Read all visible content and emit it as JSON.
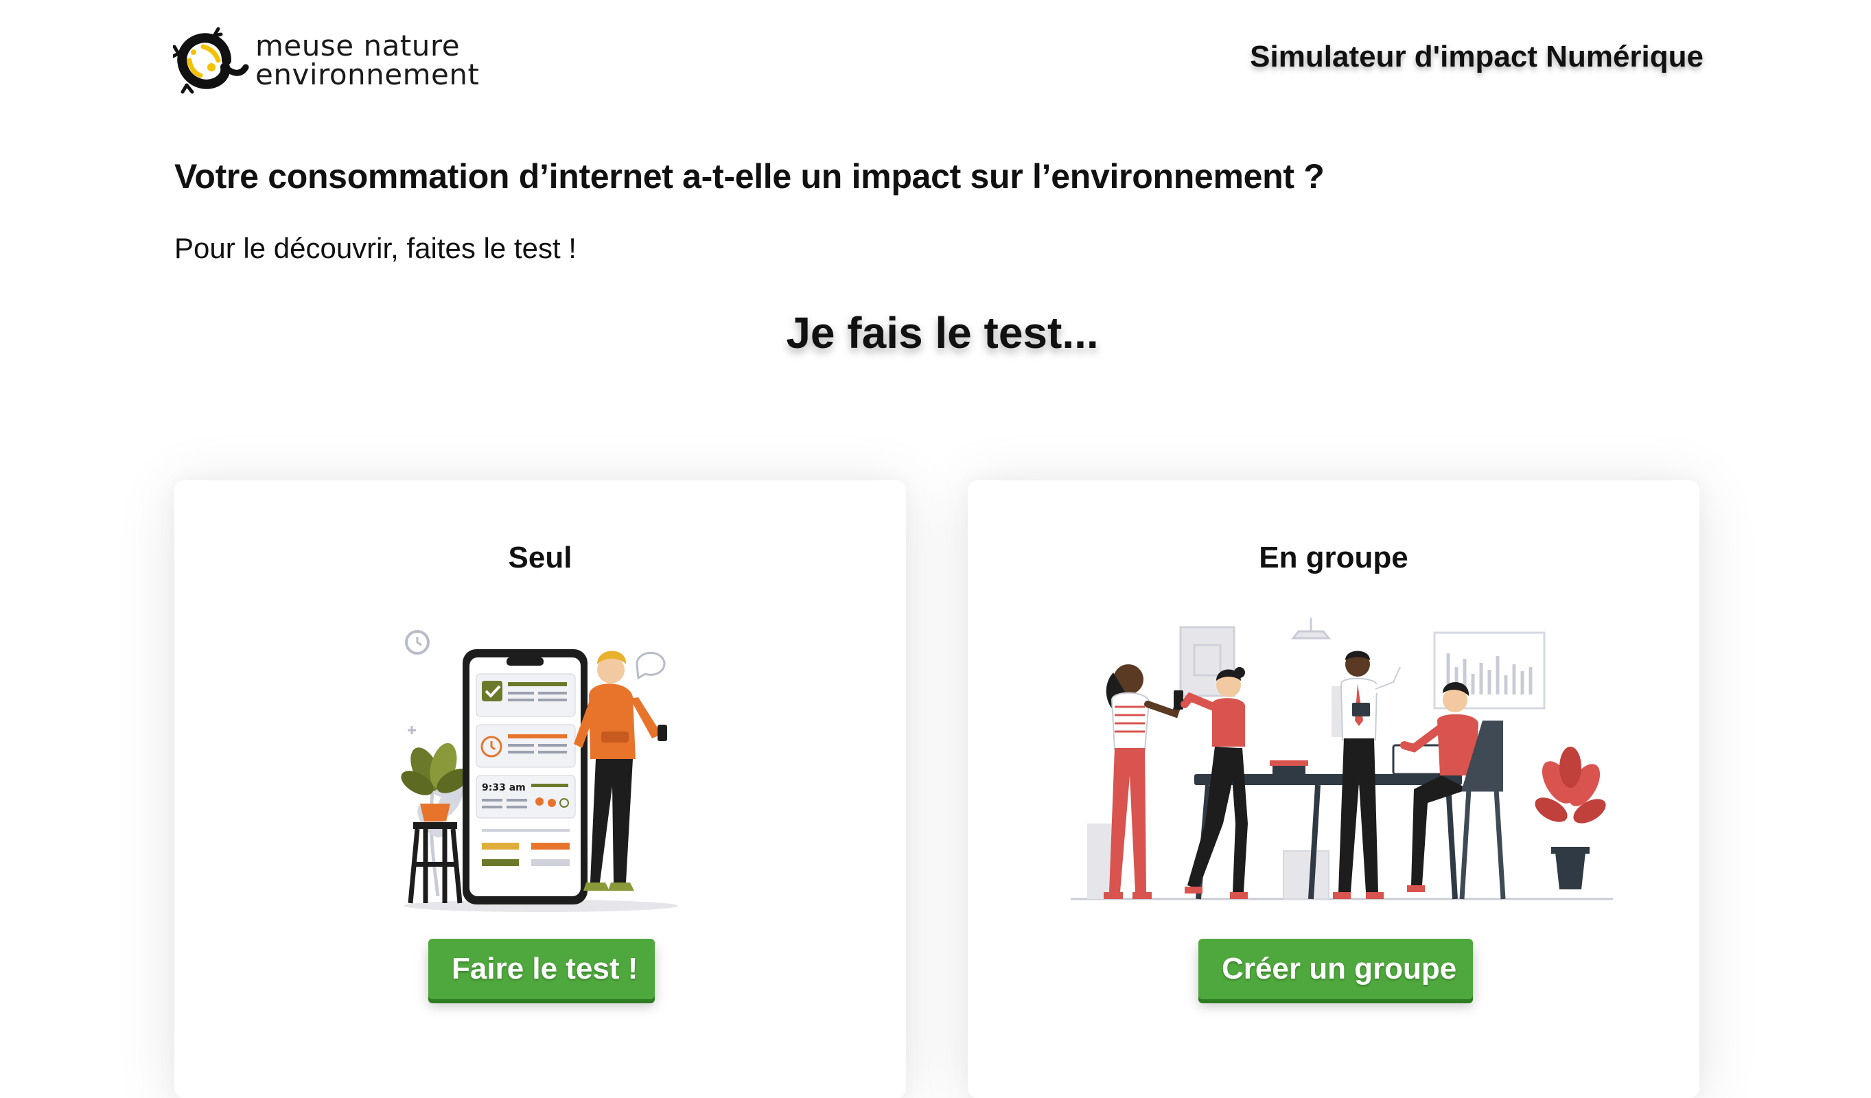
{
  "header": {
    "logo": {
      "line1": "meuse nature",
      "line2": "environnement",
      "icon": "salamander-logo-icon"
    },
    "site_title": "Simulateur d'impact Numérique"
  },
  "intro": {
    "headline": "Votre consommation d’internet a-t-elle un impact sur l’environnement ?",
    "subtitle": "Pour le découvrir, faites le test !"
  },
  "choice": {
    "title": "Je fais le test...",
    "cards": [
      {
        "title": "Seul",
        "illustration": "person-with-phone-illustration",
        "phone_time": "9:33 am",
        "button_label": "Faire le test !"
      },
      {
        "title": "En groupe",
        "illustration": "team-meeting-illustration",
        "button_label": "Créer un groupe"
      }
    ]
  },
  "colors": {
    "button_green": "#4fa83d",
    "accent_red": "#d9534f",
    "illustration_green": "#6b7a2a",
    "illustration_orange": "#e8742c"
  }
}
